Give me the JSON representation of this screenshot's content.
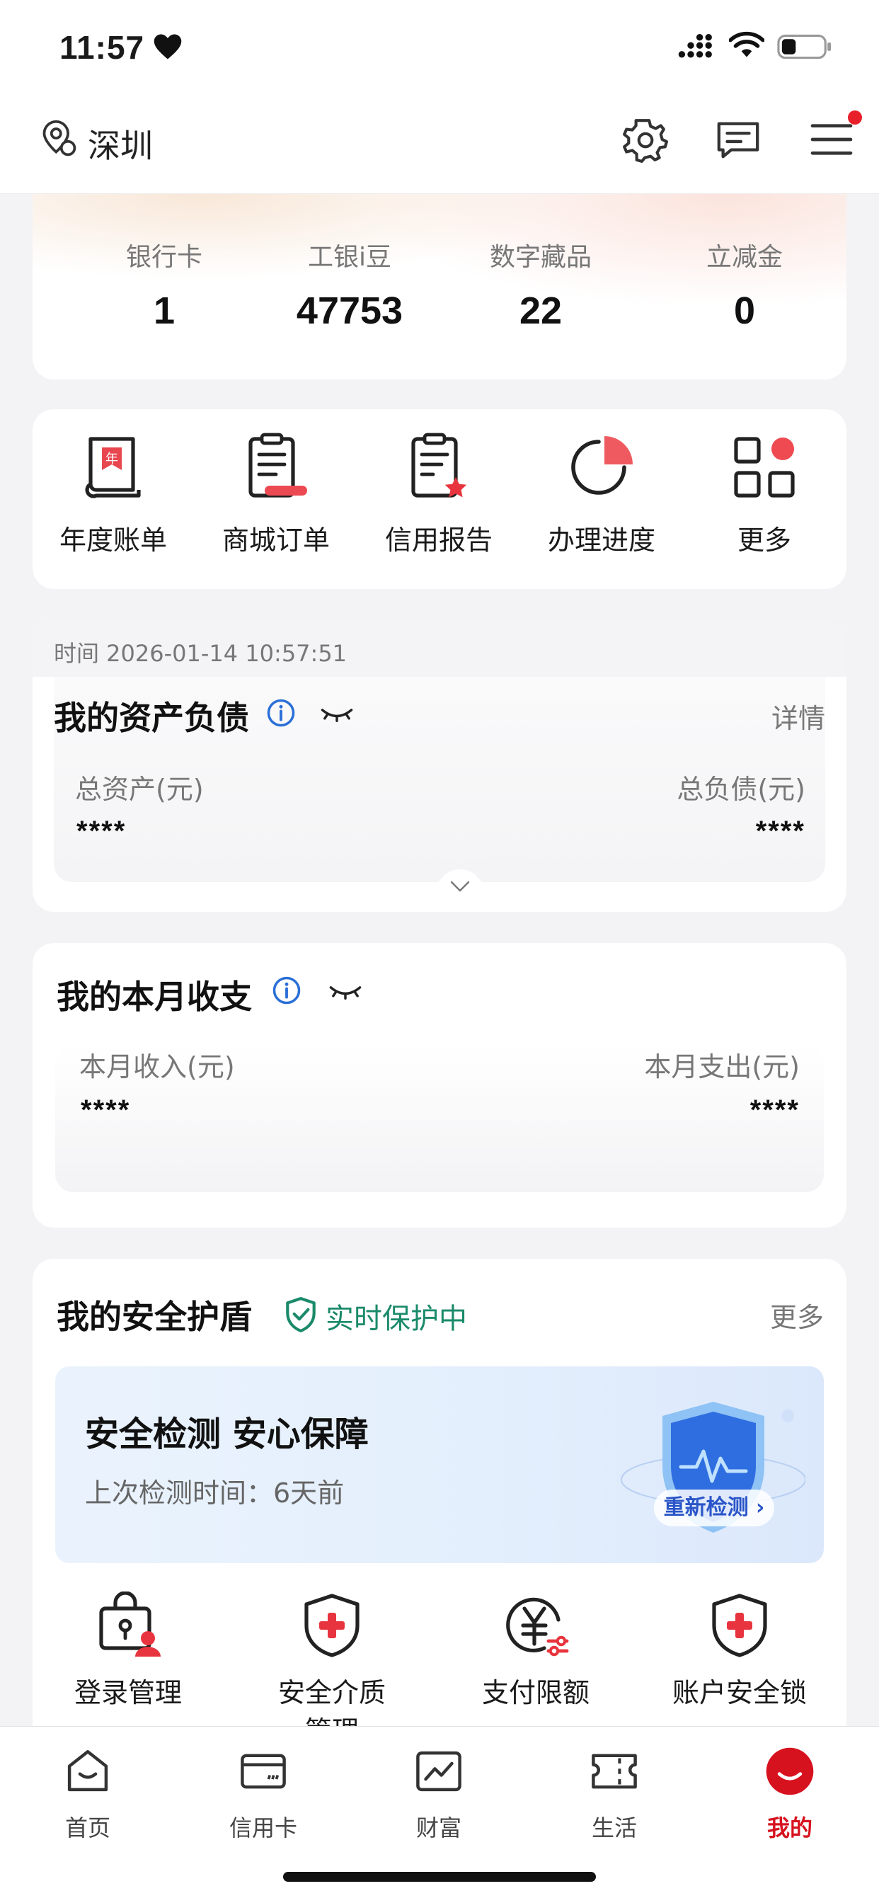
{
  "status_bar": {
    "time": "11:57",
    "icons": [
      "heart-icon",
      "signal-icon",
      "wifi-icon",
      "battery-icon"
    ]
  },
  "header": {
    "location": "深圳",
    "icons": [
      "location-icon",
      "gear-icon",
      "message-icon",
      "menu-icon"
    ]
  },
  "summary": {
    "stats": [
      {
        "label": "银行卡",
        "value": "1"
      },
      {
        "label": "工银i豆",
        "value": "47753"
      },
      {
        "label": "数字藏品",
        "value": "22"
      },
      {
        "label": "立减金",
        "value": "0"
      }
    ]
  },
  "shortcuts": [
    {
      "label": "年度账单",
      "icon": "annual-bill-icon"
    },
    {
      "label": "商城订单",
      "icon": "mall-order-icon"
    },
    {
      "label": "信用报告",
      "icon": "credit-report-icon"
    },
    {
      "label": "办理进度",
      "icon": "progress-pie-icon"
    },
    {
      "label": "更多",
      "icon": "more-grid-icon"
    }
  ],
  "assets": {
    "time": "时间 2026-01-14 10:57:51",
    "title": "我的资产负债",
    "detail": "详情",
    "total_assets_label": "总资产(元)",
    "total_assets_value": "****",
    "total_liabilities_label": "总负债(元)",
    "total_liabilities_value": "****"
  },
  "income": {
    "title": "我的本月收支",
    "income_label": "本月收入(元)",
    "income_value": "****",
    "expense_label": "本月支出(元)",
    "expense_value": "****"
  },
  "security": {
    "title": "我的安全护盾",
    "status": "实时保护中",
    "more": "更多",
    "banner_title": "安全检测 安心保障",
    "banner_sub": "上次检测时间：6天前",
    "recheck": "重新检测",
    "items": [
      {
        "label": "登录管理"
      },
      {
        "label": "安全介质管理"
      },
      {
        "label": "支付限额"
      },
      {
        "label": "账户安全锁"
      }
    ]
  },
  "tabs": [
    {
      "label": "首页",
      "active": false
    },
    {
      "label": "信用卡",
      "active": false
    },
    {
      "label": "财富",
      "active": false
    },
    {
      "label": "生活",
      "active": false
    },
    {
      "label": "我的",
      "active": true
    }
  ],
  "colors": {
    "accent": "#d7121f",
    "safe_green": "#1a8a6a",
    "info_blue": "#2a6fd6"
  }
}
